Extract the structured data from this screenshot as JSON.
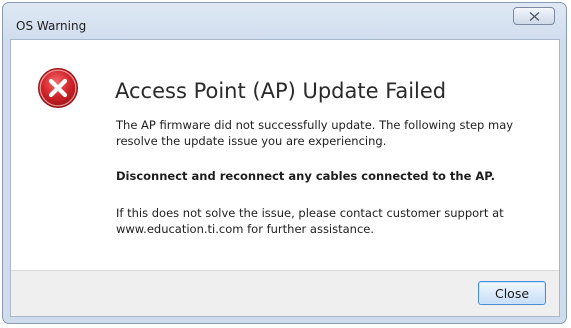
{
  "window": {
    "title": "OS Warning"
  },
  "dialog": {
    "heading": "Access Point (AP) Update Failed",
    "message": "The AP firmware did not successfully update. The following step may resolve the update issue you are experiencing.",
    "instruction": "Disconnect and reconnect any cables connected to the AP.",
    "support": "If this does not solve the issue, please contact customer support at www.education.ti.com for further assistance.",
    "icon": "error-icon",
    "accent_color": "#d2262b"
  },
  "footer": {
    "close_label": "Close"
  }
}
